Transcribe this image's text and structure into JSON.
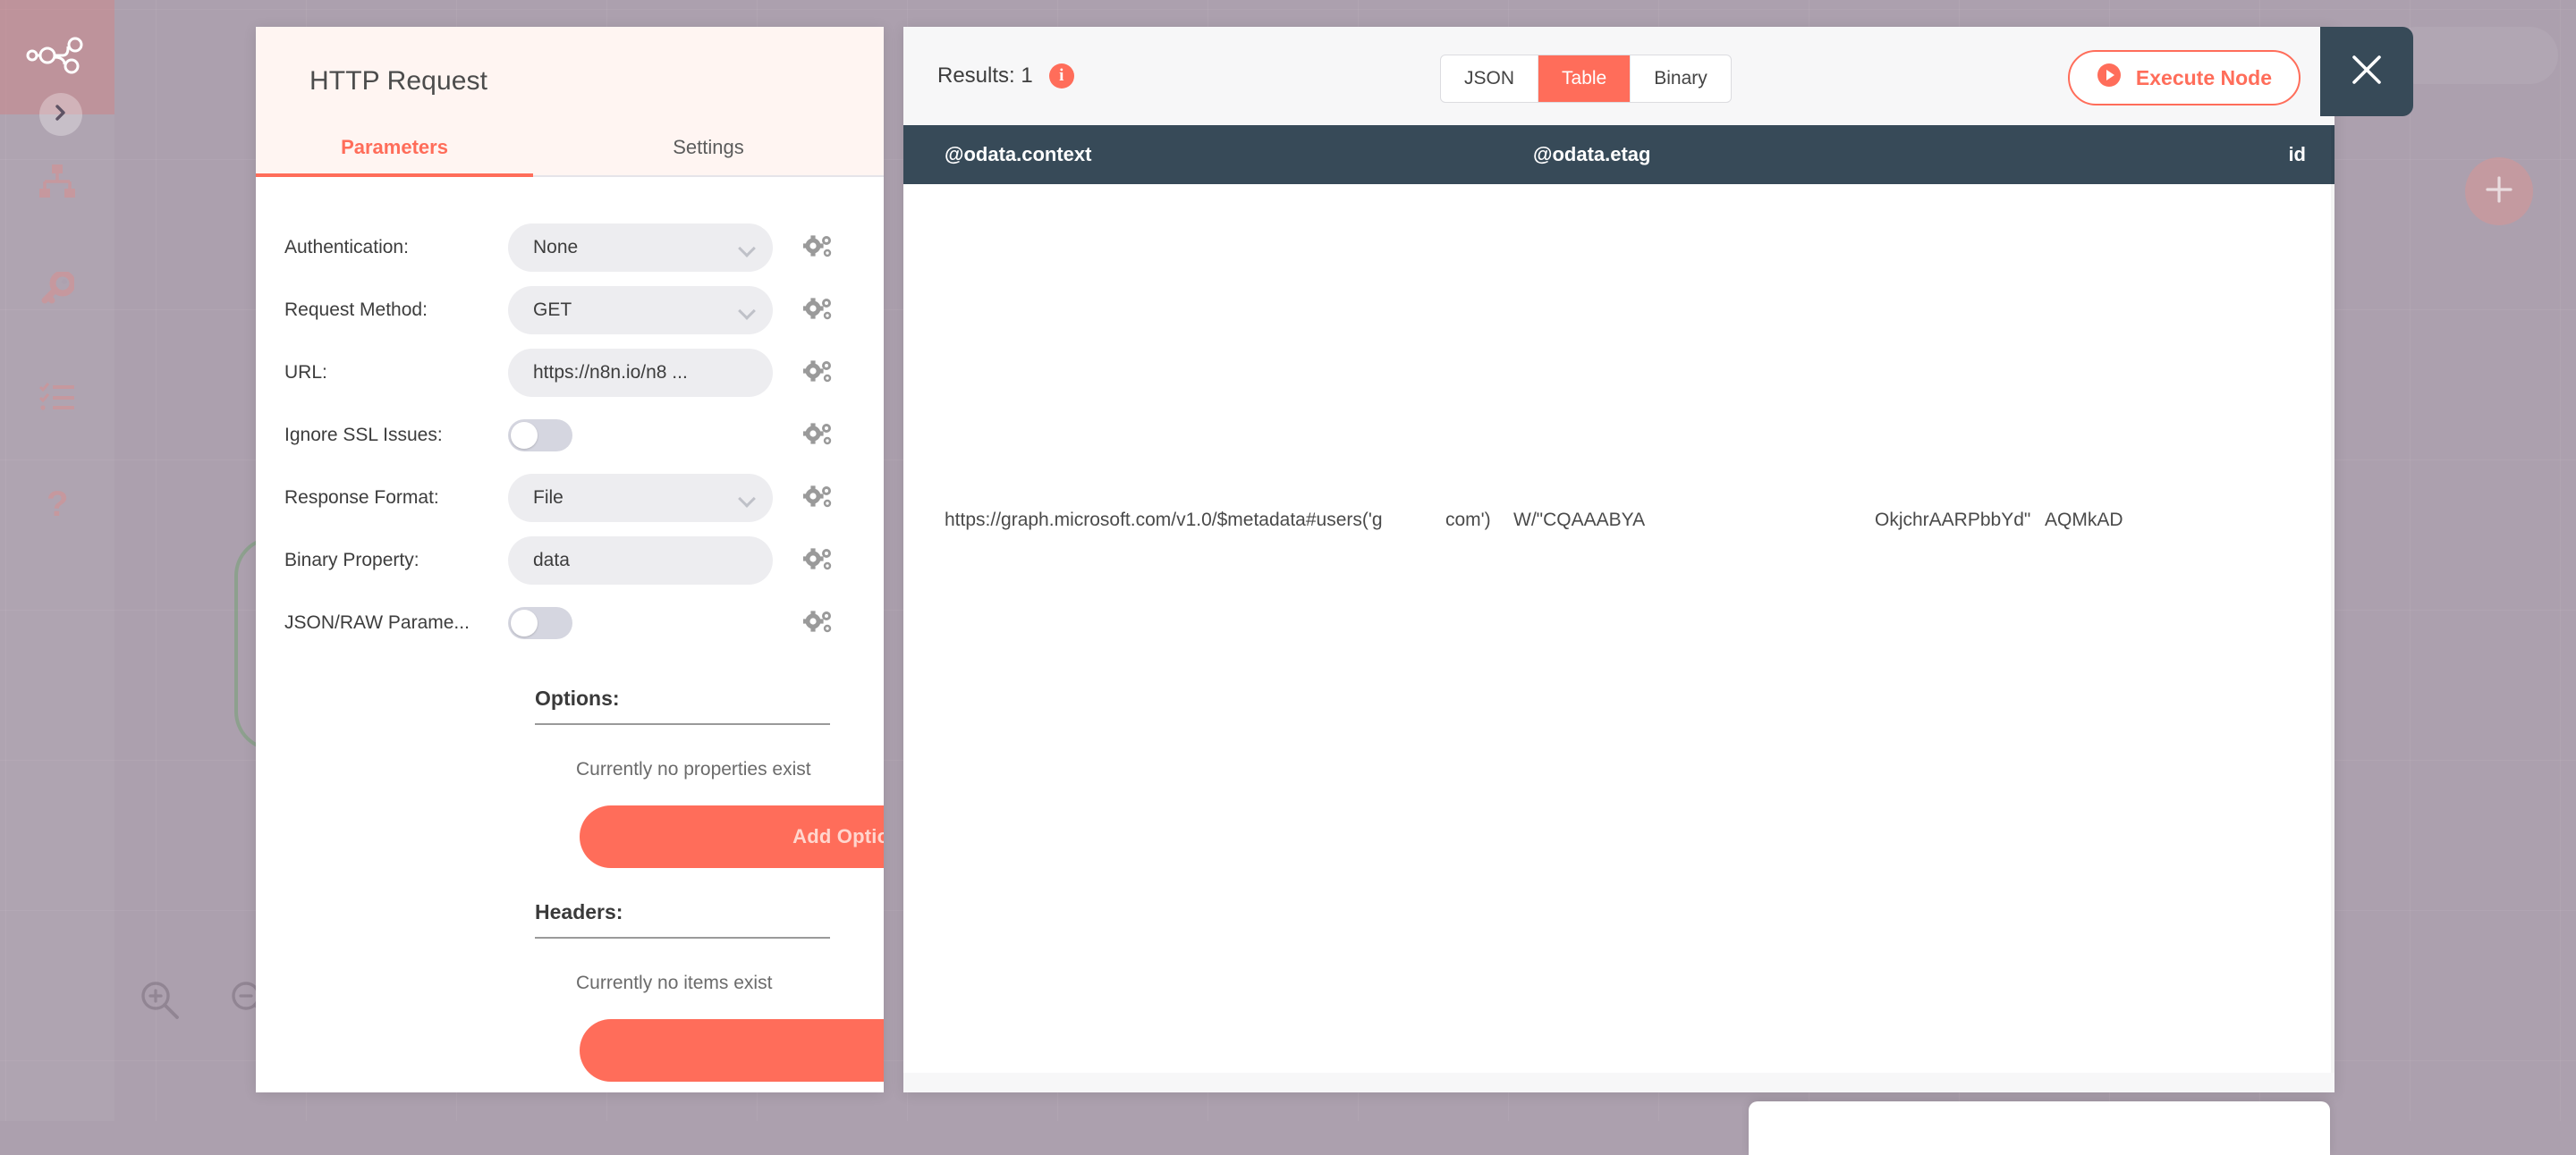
{
  "sidebar": {
    "items": [
      {
        "name": "n8n-logo",
        "icon": "workflow-logo-icon"
      },
      {
        "name": "expand-sidebar",
        "icon": "chevron-right-icon"
      },
      {
        "name": "workflows",
        "icon": "sitemap-icon"
      },
      {
        "name": "credentials",
        "icon": "key-icon"
      },
      {
        "name": "executions",
        "icon": "checklist-icon"
      },
      {
        "name": "help",
        "icon": "question-mark-icon"
      }
    ]
  },
  "canvas": {
    "zoom_in_icon": "zoom-in-icon",
    "zoom_out_icon": "zoom-out-icon",
    "add_node_icon": "plus-icon"
  },
  "node_detail": {
    "title": "HTTP Request",
    "tabs": [
      {
        "label": "Parameters",
        "active": true
      },
      {
        "label": "Settings",
        "active": false
      }
    ],
    "parameters": [
      {
        "label": "Authentication:",
        "type": "select",
        "value": "None"
      },
      {
        "label": "Request Method:",
        "type": "select",
        "value": "GET"
      },
      {
        "label": "URL:",
        "type": "text",
        "value": "https://n8n.io/n8 ..."
      },
      {
        "label": "Ignore SSL Issues:",
        "type": "toggle",
        "value": "off"
      },
      {
        "label": "Response Format:",
        "type": "select",
        "value": "File"
      },
      {
        "label": "Binary Property:",
        "type": "text",
        "value": "data"
      },
      {
        "label": "JSON/RAW Parame...",
        "type": "toggle",
        "value": "off"
      }
    ],
    "options_section": {
      "title": "Options:",
      "empty_text": "Currently no properties exist",
      "add_label": "Add Option"
    },
    "headers_section": {
      "title": "Headers:",
      "empty_text": "Currently no items exist"
    },
    "gear_icon": "gears-icon",
    "close_icon": "close-icon"
  },
  "output": {
    "results_label": "Results: 1",
    "results_info_icon": "info-icon",
    "display_tabs": [
      {
        "label": "JSON",
        "active": false
      },
      {
        "label": "Table",
        "active": true
      },
      {
        "label": "Binary",
        "active": false
      }
    ],
    "execute_button": {
      "label": "Execute Node",
      "icon": "play-circle-icon"
    },
    "table": {
      "columns": [
        "@odata.context",
        "@odata.etag",
        "id"
      ],
      "rows": [
        {
          "context": "https://graph.microsoft.com/v1.0/$metadata#users('g",
          "context_tail": "com')",
          "etag_start": "W/\"CQAAABYA",
          "etag_end": "OkjchrAARPbbYd\"",
          "id": "AQMkAD"
        }
      ]
    }
  },
  "colors": {
    "accent": "#FF6D5A",
    "header_dark": "#374A58",
    "canvas": "#ACA0AE",
    "panel_tint": "#FFF5F2"
  }
}
